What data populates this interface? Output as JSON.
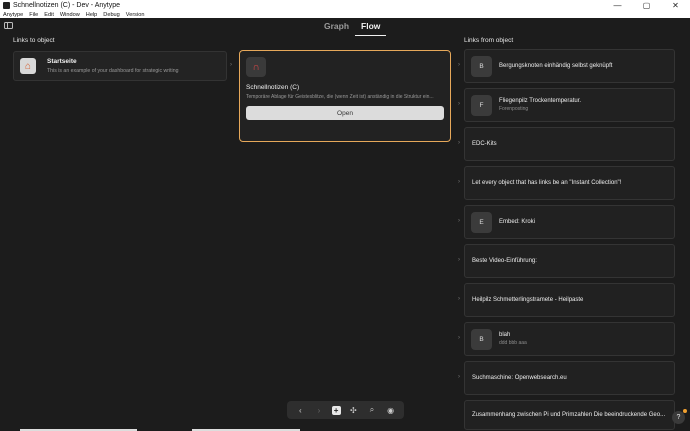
{
  "window": {
    "title": "Schnellnotizen (C) - Dev - Anytype",
    "controls": [
      "—",
      "▢",
      "✕"
    ]
  },
  "menu": [
    "Anytype",
    "File",
    "Edit",
    "Window",
    "Help",
    "Debug",
    "Version"
  ],
  "tabs": [
    {
      "label": "Graph",
      "active": false
    },
    {
      "label": "Flow",
      "active": true
    }
  ],
  "links_to": {
    "heading": "Links to object",
    "items": [
      {
        "title": "Startseite",
        "subtitle": "This is an example of your dashboard for strategic writing",
        "icon": "house-icon"
      }
    ]
  },
  "current": {
    "title": "Schnellnotizen (C)",
    "description": "Temporäre Ablage für Geistesblitze, die (wenn Zeit ist) anständig in die Struktur ein...",
    "icon": "magnet-icon",
    "open_label": "Open"
  },
  "links_from": {
    "heading": "Links from object",
    "items": [
      {
        "avatar": "B",
        "title": "Bergungsknoten einhändig selbst geknüpft",
        "subtitle": ""
      },
      {
        "avatar": "F",
        "title": "Fliegenpilz Trockentemperatur.",
        "subtitle": "Forenposting"
      },
      {
        "avatar": "",
        "title": "EDC-Kits",
        "subtitle": ""
      },
      {
        "avatar": "",
        "title": "Let every object that has links be an \"Instant Collection\"!",
        "subtitle": ""
      },
      {
        "avatar": "E",
        "title": "Embed: Kroki",
        "subtitle": ""
      },
      {
        "avatar": "",
        "title": "Beste Video-Einführung:",
        "subtitle": ""
      },
      {
        "avatar": "",
        "title": "Heilpilz Schmetterlingstramete - Heilpaste",
        "subtitle": ""
      },
      {
        "avatar": "B",
        "title": "blah",
        "subtitle": "ddd bbb aaa"
      },
      {
        "avatar": "",
        "title": "Suchmaschine: Openwebsearch.eu",
        "subtitle": ""
      },
      {
        "avatar": "",
        "title": "Zusammenhang zwischen Pi und Primzahlen Die beeindruckende Geo...",
        "subtitle": ""
      }
    ]
  },
  "bottombar": {
    "back": "‹",
    "forward": "›",
    "plus": "+",
    "graph": "✣",
    "search": "⌕",
    "more": "◉"
  },
  "help": "?"
}
